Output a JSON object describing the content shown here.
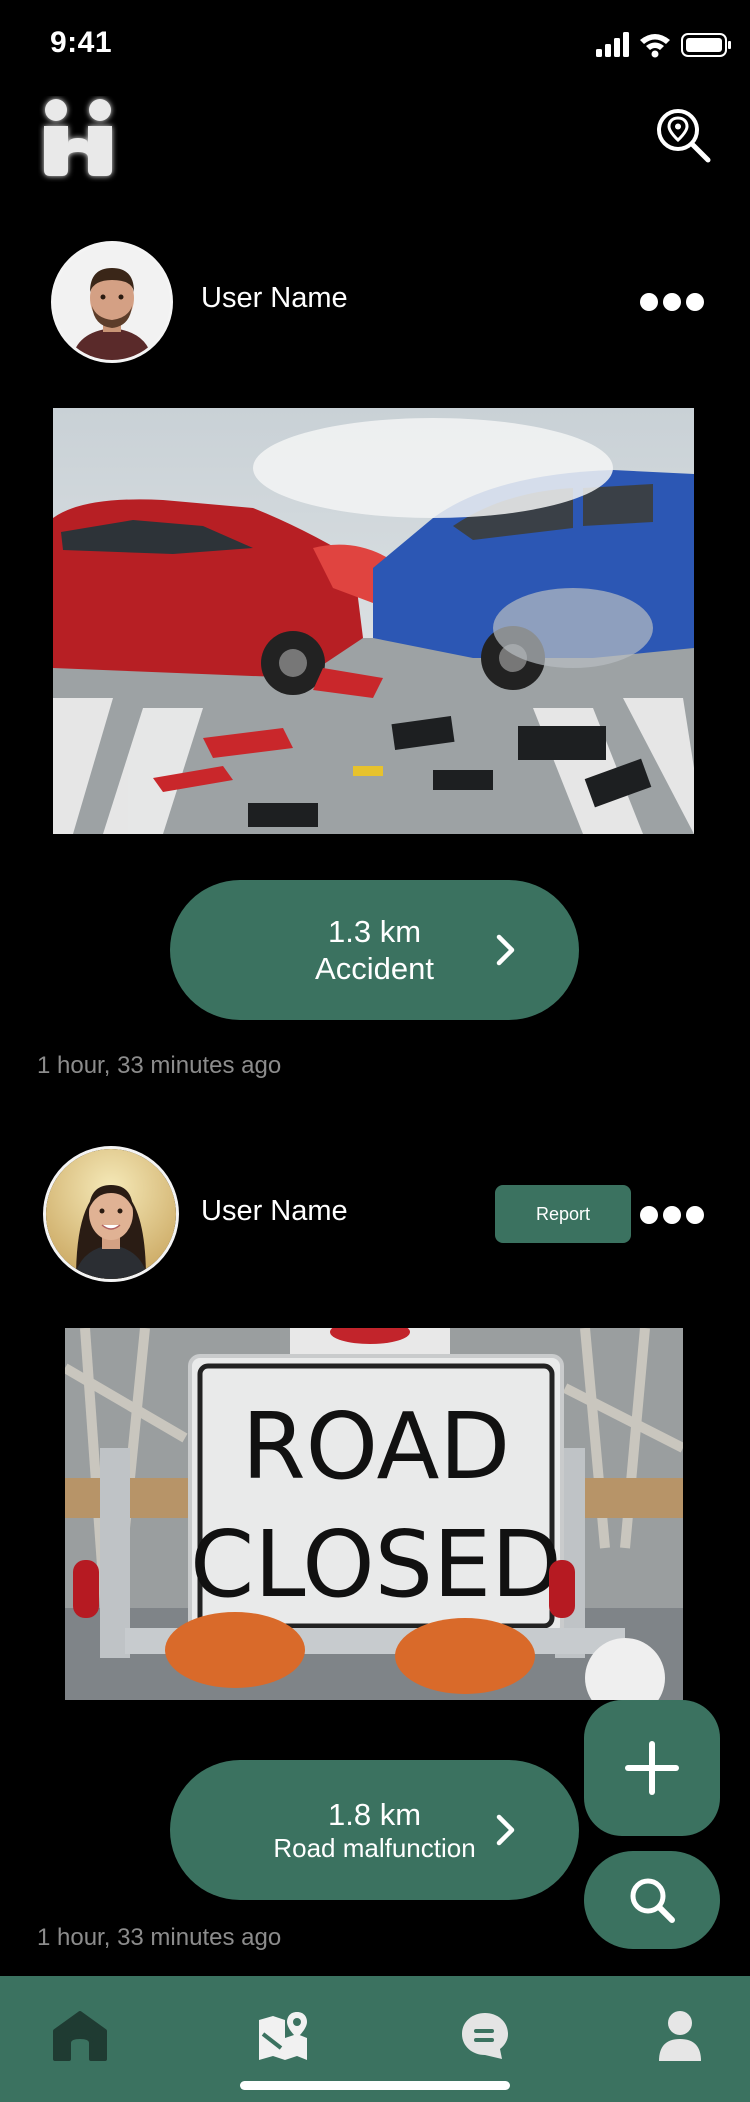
{
  "status_bar": {
    "time": "9:41"
  },
  "header": {
    "logo": "app-logo-icon",
    "action_icon": "map-pin-search-icon"
  },
  "posts": [
    {
      "user_name": "User Name",
      "avatar": "male-avatar",
      "photo": "car-accident-photo",
      "distance": "1.3 km",
      "type": "Accident",
      "time_ago": "1 hour, 33 minutes  ago",
      "has_report_button": false
    },
    {
      "user_name": "User Name",
      "avatar": "female-avatar",
      "photo": "road-closed-sign-photo",
      "sign_line1": "ROAD",
      "sign_line2": "CLOSED",
      "distance": "1.8 km",
      "type": "Road malfunction",
      "time_ago": "1 hour, 33 minutes  ago",
      "report_label": "Report",
      "has_report_button": true
    }
  ],
  "fabs": {
    "add_icon": "plus-icon",
    "search_icon": "search-icon"
  },
  "bottom_nav": {
    "items": [
      "home-icon",
      "map-icon",
      "chat-icon",
      "profile-icon"
    ],
    "active_color": "#1f3b32"
  },
  "colors": {
    "accent": "#3b7260",
    "background": "#000000",
    "muted_text": "#8c8c8c"
  }
}
